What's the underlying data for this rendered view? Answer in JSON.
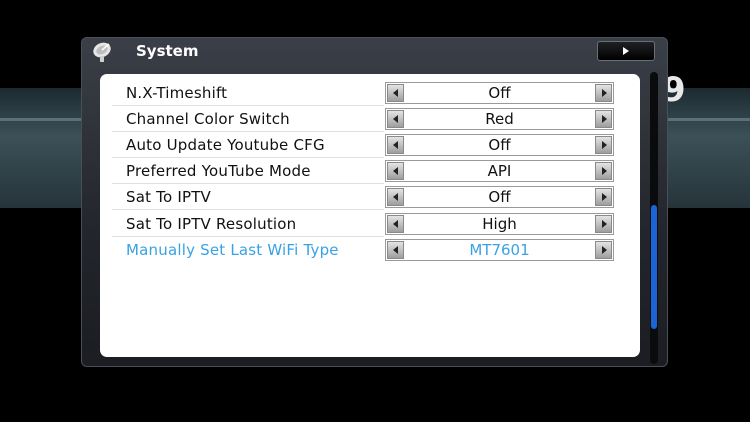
{
  "window": {
    "title": "System",
    "icon": "satellite-dish-icon"
  },
  "header_button": {
    "icon": "play-icon"
  },
  "background": {
    "glyph": "9"
  },
  "settings": [
    {
      "label": "N.X-Timeshift",
      "value": "Off"
    },
    {
      "label": "Channel Color Switch",
      "value": "Red"
    },
    {
      "label": "Auto Update Youtube CFG",
      "value": "Off"
    },
    {
      "label": "Preferred YouTube Mode",
      "value": "API"
    },
    {
      "label": "Sat To IPTV",
      "value": "Off"
    },
    {
      "label": "Sat To IPTV Resolution",
      "value": "High"
    },
    {
      "label": "Manually Set Last WiFi Type",
      "value": "MT7601"
    }
  ],
  "selected_index": 6,
  "colors": {
    "accent": "#38a2e4",
    "scroll": "#1c63d6"
  }
}
